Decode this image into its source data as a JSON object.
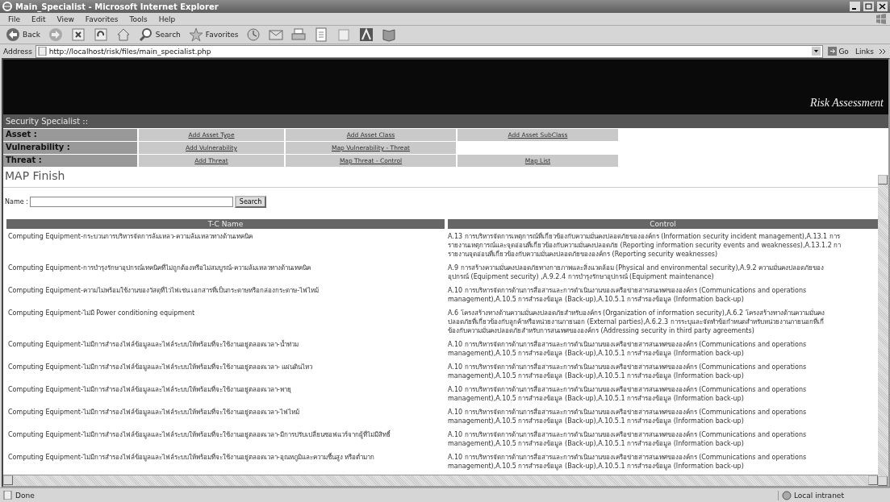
{
  "window": {
    "title": "Main_Specialist - Microsoft Internet Explorer"
  },
  "menu_bar": [
    "File",
    "Edit",
    "View",
    "Favorites",
    "Tools",
    "Help"
  ],
  "toolbar": [
    {
      "kind": "back",
      "label": "Back"
    },
    {
      "kind": "forward"
    },
    {
      "kind": "stop"
    },
    {
      "kind": "refresh"
    },
    {
      "kind": "home"
    },
    {
      "kind": "search",
      "label": "Search"
    },
    {
      "kind": "favorites",
      "label": "Favorites"
    },
    {
      "kind": "history"
    },
    {
      "kind": "mail"
    },
    {
      "kind": "print"
    },
    {
      "kind": "edit"
    },
    {
      "kind": "discuss"
    },
    {
      "kind": "messenger"
    },
    {
      "kind": "research"
    }
  ],
  "address_bar": {
    "label": "Address",
    "url": "http://localhost/risk/files/main_specialist.php",
    "go": "Go",
    "links": "Links"
  },
  "page": {
    "banner_title": "Risk Assessment",
    "section_title": "Security Specialist ::",
    "nav_rows": [
      {
        "label": "Asset :",
        "links": [
          "Add Asset Type",
          "Add Asset Class",
          "Add Asset SubClass"
        ]
      },
      {
        "label": "Vulnerability :",
        "links": [
          "Add Vulnerability",
          "Map Vulnerability - Threat"
        ]
      },
      {
        "label": "Threat :",
        "links": [
          "Add Threat",
          "Map Threat - Control",
          "Map List"
        ]
      }
    ],
    "heading": "MAP Finish",
    "search": {
      "label": "Name :",
      "button": "Search"
    },
    "table": {
      "columns": [
        "T-C Name",
        "Control"
      ],
      "rows": [
        {
          "tc_name": "Computing Equipment-กระบวนการบริหารจัดการล้มเหลว-ความล้มเหลวทางด้านเทคนิค",
          "control_lines": [
            "A.13 การบริหารจัดการเหตุการณ์ที่เกี่ยวข้องกับความมั่นคงปลอดภัยขององค์กร (Information security incident management),A.13.1 การ",
            "รายงานเหตุการณ์และจุดอ่อนที่เกี่ยวข้องกับความมั่นคงปลอดภัย (Reporting information security events and weaknesses),A.13.1.2 กา",
            "รายงานจุดอ่อนที่เกี่ยวข้องกับความมั่นคงปลอดภัยขององค์กร (Reporting security weaknesses)"
          ]
        },
        {
          "tc_name": "Computing Equipment-การบำรุงรักษาอุปกรณ์เทคนิคที่ไม่ถูกต้องหรือไม่สมบูรณ์-ความล้มเหลวทางด้านเทคนิค",
          "control_lines": [
            "A.9 การสร้างความมั่นคงปลอดภัยทางกายภาพและสิ่งแวดล้อม (Physical and environmental security),A.9.2 ความมั่นคงปลอดภัยของ",
            "อุปกรณ์ (Equipment security) ,A.9.2.4 การบำรุงรักษาอุปกรณ์ (Equipment maintenance)"
          ]
        },
        {
          "tc_name": "Computing Equipment-ความไม่พร้อมใช้งานของวัสดุที่ไวไฟเช่น เอกสารที่เป็นกระดาษหรือกล่องกระดาษ-ไฟไหม้",
          "control_lines": [
            "A.10 การบริหารจัดการด้านการสื่อสารและการดำเนินงานของเครือข่ายสารสนเทศขององค์กร (Communications and operations",
            "management),A.10.5 การสำรองข้อมูล (Back-up),A.10.5.1 การสำรองข้อมูล (Information back-up)"
          ]
        },
        {
          "tc_name": "Computing Equipment-ไม่มี Power conditioning equipment",
          "control_lines": [
            "A.6 โครงสร้างทางด้านความมั่นคงปลอดภัยสำหรับองค์กร (Organization of information security),A.6.2 โครงสร้างทางด้านความมั่นคง",
            "ปลอดภัยที่เกี่ยวข้องกับลูกค้าหรือหน่วยงานภายนอก (External parties),A.6.2.3 การระบุและจัดทำข้อกำหนดสำหรับหน่วยงานภายนอกที่เกี่",
            "ข้องกับความมั่นคงปลอดภัยสำหรับการสนเทศขององค์กร (Addressing security in third party agreements)"
          ]
        },
        {
          "tc_name": "Computing Equipment-ไม่มีการสำรองไฟล์ข้อมูลและไฟล์ระบบให้พร้อมที่จะใช้งานอยู่ตลอดเวลา-น้ำท่วม",
          "control_lines": [
            "A.10 การบริหารจัดการด้านการสื่อสารและการดำเนินงานของเครือข่ายสารสนเทศขององค์กร (Communications and operations",
            "management),A.10.5 การสำรองข้อมูล (Back-up),A.10.5.1 การสำรองข้อมูล (Information back-up)"
          ]
        },
        {
          "tc_name": "Computing Equipment-ไม่มีการสำรองไฟล์ข้อมูลและไฟล์ระบบให้พร้อมที่จะใช้งานอยู่ตลอดเวลา- แผ่นดินไหว",
          "control_lines": [
            "A.10 การบริหารจัดการด้านการสื่อสารและการดำเนินงานของเครือข่ายสารสนเทศขององค์กร (Communications and operations",
            "management),A.10.5 การสำรองข้อมูล (Back-up),A.10.5.1 การสำรองข้อมูล (Information back-up)"
          ]
        },
        {
          "tc_name": "Computing Equipment-ไม่มีการสำรองไฟล์ข้อมูลและไฟล์ระบบให้พร้อมที่จะใช้งานอยู่ตลอดเวลา-พายุ",
          "control_lines": [
            "A.10 การบริหารจัดการด้านการสื่อสารและการดำเนินงานของเครือข่ายสารสนเทศขององค์กร (Communications and operations",
            "management),A.10.5 การสำรองข้อมูล (Back-up),A.10.5.1 การสำรองข้อมูล (Information back-up)"
          ]
        },
        {
          "tc_name": "Computing Equipment-ไม่มีการสำรองไฟล์ข้อมูลและไฟล์ระบบให้พร้อมที่จะใช้งานอยู่ตลอดเวลา-ไฟไหม้",
          "control_lines": [
            "A.10 การบริหารจัดการด้านการสื่อสารและการดำเนินงานของเครือข่ายสารสนเทศขององค์กร (Communications and operations",
            "management),A.10.5 การสำรองข้อมูล (Back-up),A.10.5.1 การสำรองข้อมูล (Information back-up)"
          ]
        },
        {
          "tc_name": "Computing Equipment-ไม่มีการสำรองไฟล์ข้อมูลและไฟล์ระบบให้พร้อมที่จะใช้งานอยู่ตลอดเวลา-มีการปรับเปลี่ยนซอฟแวร์จากผู้ที่ไม่มีสิทธิ์",
          "control_lines": [
            "A.10 การบริหารจัดการด้านการสื่อสารและการดำเนินงานของเครือข่ายสารสนเทศขององค์กร (Communications and operations",
            "management),A.10.5 การสำรองข้อมูล (Back-up),A.10.5.1 การสำรองข้อมูล (Information back-up)"
          ]
        },
        {
          "tc_name": "Computing Equipment-ไม่มีการสำรองไฟล์ข้อมูลและไฟล์ระบบให้พร้อมที่จะใช้งานอยู่ตลอดเวลา-อุณหภูมิและความชื้นสูง หรือต่ำมาก",
          "control_lines": [
            "A.10 การบริหารจัดการด้านการสื่อสารและการดำเนินงานของเครือข่ายสารสนเทศขององค์กร (Communications and operations",
            "management),A.10.5 การสำรองข้อมูล (Back-up),A.10.5.1 การสำรองข้อมูล (Information back-up)"
          ]
        }
      ]
    }
  },
  "status_bar": {
    "text": "Done",
    "zone": "Local intranet"
  }
}
